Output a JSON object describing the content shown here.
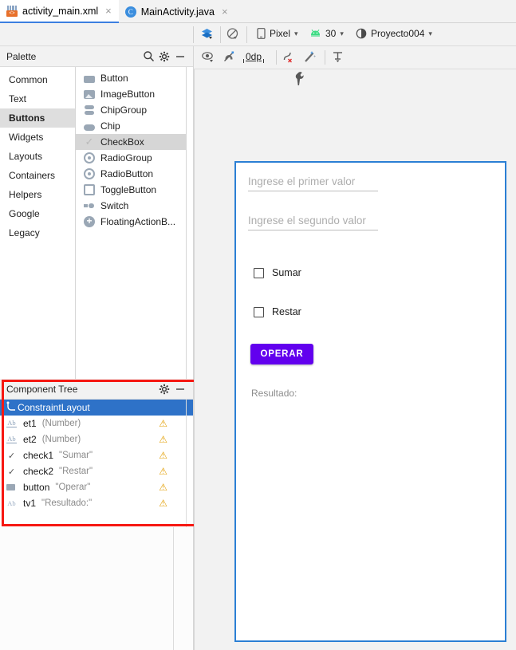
{
  "tabs": [
    {
      "label": "activity_main.xml",
      "icon": "xml-layout-icon",
      "active": true,
      "close": "×"
    },
    {
      "label": "MainActivity.java",
      "icon": "java-class-icon",
      "active": false,
      "close": "×"
    }
  ],
  "toolbar": {
    "search_icon": "search-icon",
    "settings_icon": "gear-icon",
    "minimize_icon": "minimize-icon",
    "layers_icon": "design-layers-icon",
    "blueprint_icon": "blueprint-off-icon",
    "device_label": "Pixel",
    "device_icon": "phone-icon",
    "api_label": "30",
    "api_icon": "android-robot-icon",
    "theme_label": "Proyecto004",
    "theme_icon": "theme-circle-icon",
    "caret": "⌄"
  },
  "toolbar2": {
    "view_options_icon": "eye-icon",
    "autoconnect_icon": "magnet-off-icon",
    "default_margin_value": "0dp",
    "clear_constraints_icon": "clear-constraints-icon",
    "infer_constraints_icon": "magic-wand-icon",
    "guidelines_icon": "guidelines-icon"
  },
  "palette": {
    "title": "Palette",
    "search_icon": "search-icon",
    "settings_icon": "gear-icon",
    "minimize_icon": "minimize-icon",
    "categories": [
      {
        "label": "Common",
        "selected": false
      },
      {
        "label": "Text",
        "selected": false
      },
      {
        "label": "Buttons",
        "selected": true
      },
      {
        "label": "Widgets",
        "selected": false
      },
      {
        "label": "Layouts",
        "selected": false
      },
      {
        "label": "Containers",
        "selected": false
      },
      {
        "label": "Helpers",
        "selected": false
      },
      {
        "label": "Google",
        "selected": false
      },
      {
        "label": "Legacy",
        "selected": false
      }
    ],
    "items": [
      {
        "label": "Button",
        "icon": "button-icon",
        "selected": false
      },
      {
        "label": "ImageButton",
        "icon": "image-button-icon",
        "selected": false
      },
      {
        "label": "ChipGroup",
        "icon": "chip-group-icon",
        "selected": false
      },
      {
        "label": "Chip",
        "icon": "chip-icon",
        "selected": false
      },
      {
        "label": "CheckBox",
        "icon": "checkbox-icon",
        "selected": true
      },
      {
        "label": "RadioGroup",
        "icon": "radio-group-icon",
        "selected": false
      },
      {
        "label": "RadioButton",
        "icon": "radio-button-icon",
        "selected": false
      },
      {
        "label": "ToggleButton",
        "icon": "toggle-button-icon",
        "selected": false
      },
      {
        "label": "Switch",
        "icon": "switch-icon",
        "selected": false
      },
      {
        "label": "FloatingActionB...",
        "icon": "fab-icon",
        "selected": false
      }
    ]
  },
  "component_tree": {
    "title": "Component Tree",
    "settings_icon": "gear-icon",
    "minimize_icon": "minimize-icon",
    "rows": [
      {
        "id": "ConstraintLayout",
        "attr": "",
        "icon": "constraint-layout-icon",
        "selected": true,
        "warning": false
      },
      {
        "id": "et1",
        "attr": "(Number)",
        "icon": "text-ab-icon",
        "selected": false,
        "warning": true
      },
      {
        "id": "et2",
        "attr": "(Number)",
        "icon": "text-ab-icon",
        "selected": false,
        "warning": true
      },
      {
        "id": "check1",
        "attr": "\"Sumar\"",
        "icon": "checkbox-icon",
        "selected": false,
        "warning": true
      },
      {
        "id": "check2",
        "attr": "\"Restar\"",
        "icon": "checkbox-icon",
        "selected": false,
        "warning": true
      },
      {
        "id": "button",
        "attr": "\"Operar\"",
        "icon": "button-icon",
        "selected": false,
        "warning": true
      },
      {
        "id": "tv1",
        "attr": "\"Resultado:\"",
        "icon": "text-ab-icon",
        "selected": false,
        "warning": true
      }
    ],
    "warning_glyph": "⚠"
  },
  "preview": {
    "wrench_icon": "wrench-icon",
    "field1_hint": "Ingrese el primer valor",
    "field2_hint": "Ingrese el segundo valor",
    "checkbox1_label": "Sumar",
    "checkbox2_label": "Restar",
    "button_label": "OPERAR",
    "result_label": "Resultado:"
  },
  "colors": {
    "accent_purple": "#6200ee",
    "selection_blue": "#2e72c8",
    "annotation_red": "#f61812",
    "device_border_blue": "#2b7fd4",
    "warning_amber": "#e3a008",
    "android_green": "#3ddc84"
  }
}
